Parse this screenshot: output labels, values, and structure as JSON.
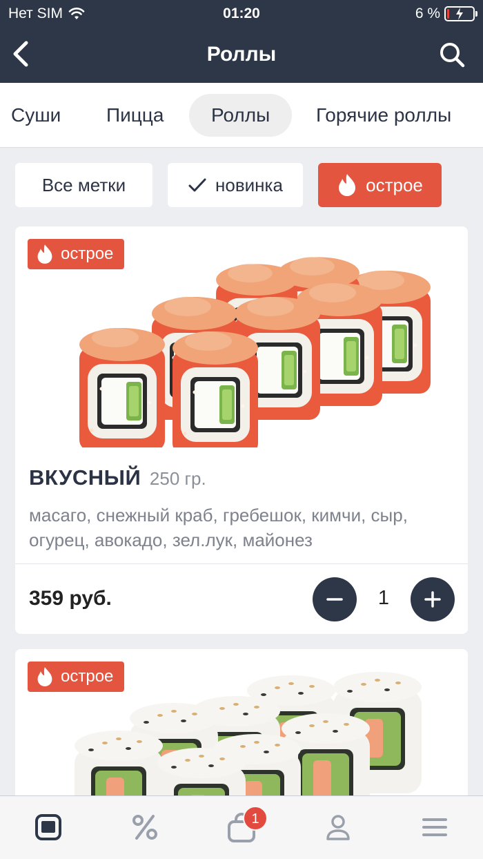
{
  "status_bar": {
    "carrier": "Нет SIM",
    "time": "01:20",
    "battery_percent": "6 %",
    "battery_level": 0.06
  },
  "nav": {
    "title": "Роллы"
  },
  "category_tabs": [
    {
      "label": "Суши",
      "active": false
    },
    {
      "label": "Пицца",
      "active": false
    },
    {
      "label": "Роллы",
      "active": true
    },
    {
      "label": "Горячие роллы",
      "active": false
    }
  ],
  "filter_chips": [
    {
      "label": "Все метки"
    },
    {
      "label": "новинка",
      "icon": "check-icon"
    },
    {
      "label": "острое",
      "icon": "flame-icon",
      "active": true
    }
  ],
  "products": [
    {
      "badge": "острое",
      "name": "ВКУСНЫЙ",
      "weight": "250 гр.",
      "description": "масаго, снежный краб, гребешок, кимчи, сыр, огурец, авокадо, зел.лук, майонез",
      "price": "359 руб.",
      "quantity": "1"
    },
    {
      "badge": "острое"
    }
  ],
  "tab_bar": {
    "items": [
      "menu-icon",
      "percent-icon",
      "cart-icon",
      "profile-icon",
      "hamburger-icon"
    ],
    "cart_count": "1"
  },
  "colors": {
    "header": "#2d3748",
    "accent": "#e45540",
    "background": "#eceef2"
  }
}
